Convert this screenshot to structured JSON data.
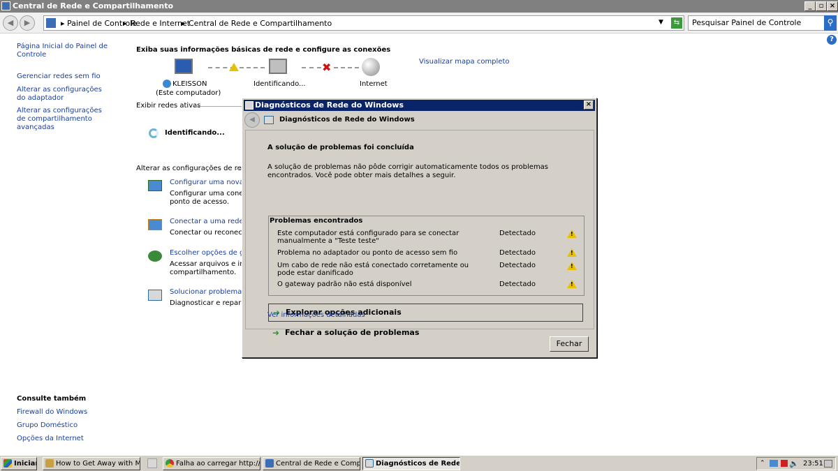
{
  "window": {
    "title": "Central de Rede e Compartilhamento"
  },
  "address": {
    "crumbs": [
      "Painel de Controle",
      "Rede e Internet",
      "Central de Rede e Compartilhamento"
    ],
    "search_placeholder": "Pesquisar Painel de Controle"
  },
  "sidebar": {
    "items": [
      "Página Inicial do Painel de Controle",
      "Gerenciar redes sem fio",
      "Alterar as configurações do adaptador",
      "Alterar as configurações de compartilhamento avançadas"
    ],
    "see_also_title": "Consulte também",
    "see_also": [
      "Firewall do Windows",
      "Grupo Doméstico",
      "Opções da Internet"
    ]
  },
  "main": {
    "title": "Exiba suas informações básicas de rede e configure as conexões",
    "view_map": "Visualizar mapa completo",
    "nodes": {
      "computer": "KLEISSON",
      "computer_sub": "(Este computador)",
      "identifying": "Identificando...",
      "internet": "Internet"
    },
    "active_networks": "Exibir redes ativas",
    "identifying_status": "Identificando...",
    "change_settings": "Alterar as configurações de rede",
    "tasks": [
      {
        "title": "Configurar uma nova co",
        "desc1": "Configurar uma conexão",
        "desc2": "ponto de acesso."
      },
      {
        "title": "Conectar a uma rede",
        "desc1": "Conectar ou reconectar",
        "desc2": ""
      },
      {
        "title": "Escolher opções de grup",
        "desc1": "Acessar arquivos e impre",
        "desc2": "compartilhamento."
      },
      {
        "title": "Solucionar problemas",
        "desc1": "Diagnosticar e reparar p",
        "desc2": ""
      }
    ]
  },
  "dialog": {
    "title": "Diagnósticos de Rede do Windows",
    "header": "Diagnósticos de Rede do Windows",
    "heading": "A solução de problemas foi concluída",
    "message": "A solução de problemas não pôde corrigir automaticamente todos os problemas encontrados. Você pode obter mais detalhes a seguir.",
    "problems_title": "Problemas encontrados",
    "problems": [
      {
        "text": "Este computador está configurado para se conectar manualmente a \"Teste teste\"",
        "status": "Detectado"
      },
      {
        "text": "Problema no adaptador ou ponto de acesso sem fio",
        "status": "Detectado"
      },
      {
        "text": "Um cabo de rede não está conectado corretamente ou pode estar danificado",
        "status": "Detectado"
      },
      {
        "text": "O gateway padrão não está disponível",
        "status": "Detectado"
      }
    ],
    "explore": "Explorar opções adicionais",
    "close_troubleshoot": "Fechar a solução de problemas",
    "details_link": "Ver informações detalhadas",
    "close_button": "Fechar"
  },
  "taskbar": {
    "start": "Iniciar",
    "tasks": [
      "How to Get Away with M...",
      "Falha ao carregar http://...",
      "Central de Rede e Comp...",
      "Diagnósticos de Rede..."
    ],
    "clock": "23:51"
  }
}
